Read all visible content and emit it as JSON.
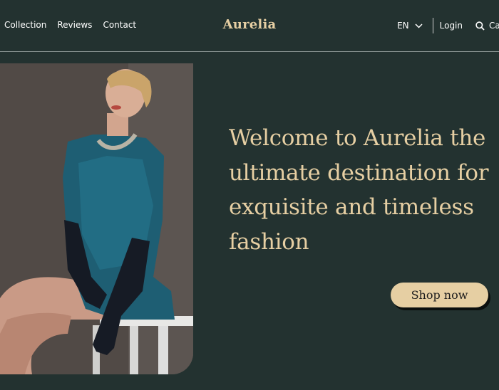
{
  "nav": {
    "links": [
      "Collection",
      "Reviews",
      "Contact"
    ],
    "brand": "Aurelia",
    "language": "EN",
    "login": "Login",
    "cart_partial": "Ca"
  },
  "hero": {
    "headline": "Welcome to Aurelia the ultimate destination for exquisite and timeless fashion",
    "cta": "Shop now"
  },
  "colors": {
    "background": "#233230",
    "accent": "#e6cfa3",
    "button_text": "#1c1c1c"
  },
  "icons": {
    "language_dropdown": "chevron-down-icon",
    "search": "search-icon"
  }
}
